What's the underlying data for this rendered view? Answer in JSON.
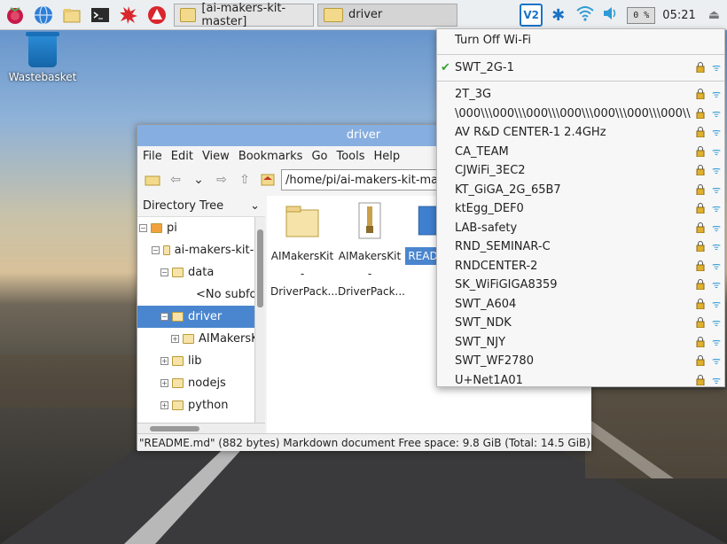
{
  "taskbar": {
    "tasks": [
      "[ai-makers-kit-master]",
      "driver"
    ],
    "cpu": "0 %",
    "clock": "05:21",
    "vnc_label": "V2"
  },
  "desktop": {
    "trash_label": "Wastebasket"
  },
  "window": {
    "title": "driver",
    "menu": [
      "File",
      "Edit",
      "View",
      "Bookmarks",
      "Go",
      "Tools",
      "Help"
    ],
    "path": "/home/pi/ai-makers-kit-master",
    "pane_label": "Directory Tree",
    "tree": [
      {
        "label": "pi"
      },
      {
        "label": "ai-makers-kit-m"
      },
      {
        "label": "data"
      },
      {
        "label": "<No subfold"
      },
      {
        "label": "driver"
      },
      {
        "label": "AIMakersKi"
      },
      {
        "label": "lib"
      },
      {
        "label": "nodejs"
      },
      {
        "label": "python"
      }
    ],
    "files": [
      {
        "line1": "AIMakersKit",
        "line2": "-",
        "line3": "DriverPack..."
      },
      {
        "line1": "AIMakersKit",
        "line2": "-",
        "line3": "DriverPack..."
      },
      {
        "line1": "READ",
        "line2": "",
        "line3": ""
      }
    ],
    "status": "\"README.md\" (882 bytes) Markdown document     Free space: 9.8 GiB (Total: 14.5 GiB)"
  },
  "wifi_menu": {
    "turn_off": "Turn Off Wi-Fi",
    "connected": "SWT_2G-1",
    "networks": [
      "2T_3G",
      "\\000\\\\\\000\\\\\\000\\\\\\000\\\\\\000\\\\\\000\\\\\\000\\\\",
      "AV R&D CENTER-1 2.4GHz",
      "CA_TEAM",
      "CJWiFi_3EC2",
      "KT_GiGA_2G_65B7",
      "ktEgg_DEF0",
      "LAB-safety",
      "RND_SEMINAR-C",
      "RNDCENTER-2",
      "SK_WiFiGIGA8359",
      "SWT_A604",
      "SWT_NDK",
      "SWT_NJY",
      "SWT_WF2780",
      "U+Net1A01"
    ]
  },
  "colors": {
    "selection": "#4a86cf",
    "titlebar": "#87aee0",
    "accent": "#2e9bd6"
  }
}
